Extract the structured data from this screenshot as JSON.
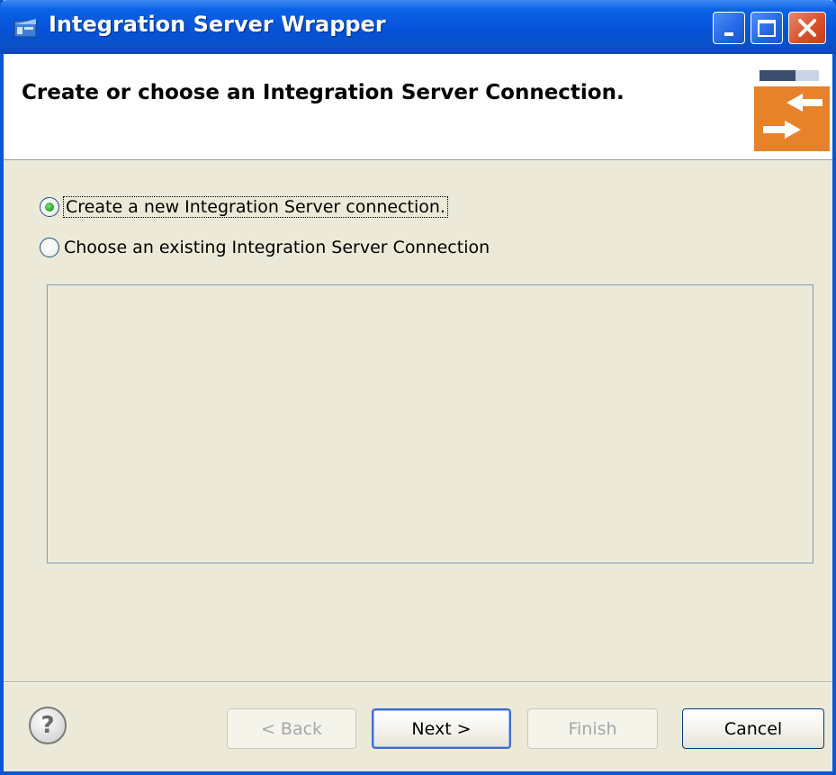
{
  "window": {
    "title": "Integration Server Wrapper"
  },
  "header": {
    "title": "Create or choose an Integration Server Connection."
  },
  "options": {
    "create_label": "Create a new Integration Server connection.",
    "create_selected": true,
    "choose_label": "Choose an existing Integration Server Connection",
    "choose_selected": false
  },
  "footer": {
    "help_glyph": "?",
    "back_label": "< Back",
    "next_label": "Next >",
    "finish_label": "Finish",
    "cancel_label": "Cancel"
  },
  "icons": {
    "app": "wizard-app-icon",
    "header_graphic": "connection-arrows-icon",
    "help": "help-icon"
  },
  "colors": {
    "titlebar": "#0553d9",
    "header_accent": "#e8822a",
    "radio_selected": "#21a121",
    "dialog_bg": "#ece9d8"
  }
}
